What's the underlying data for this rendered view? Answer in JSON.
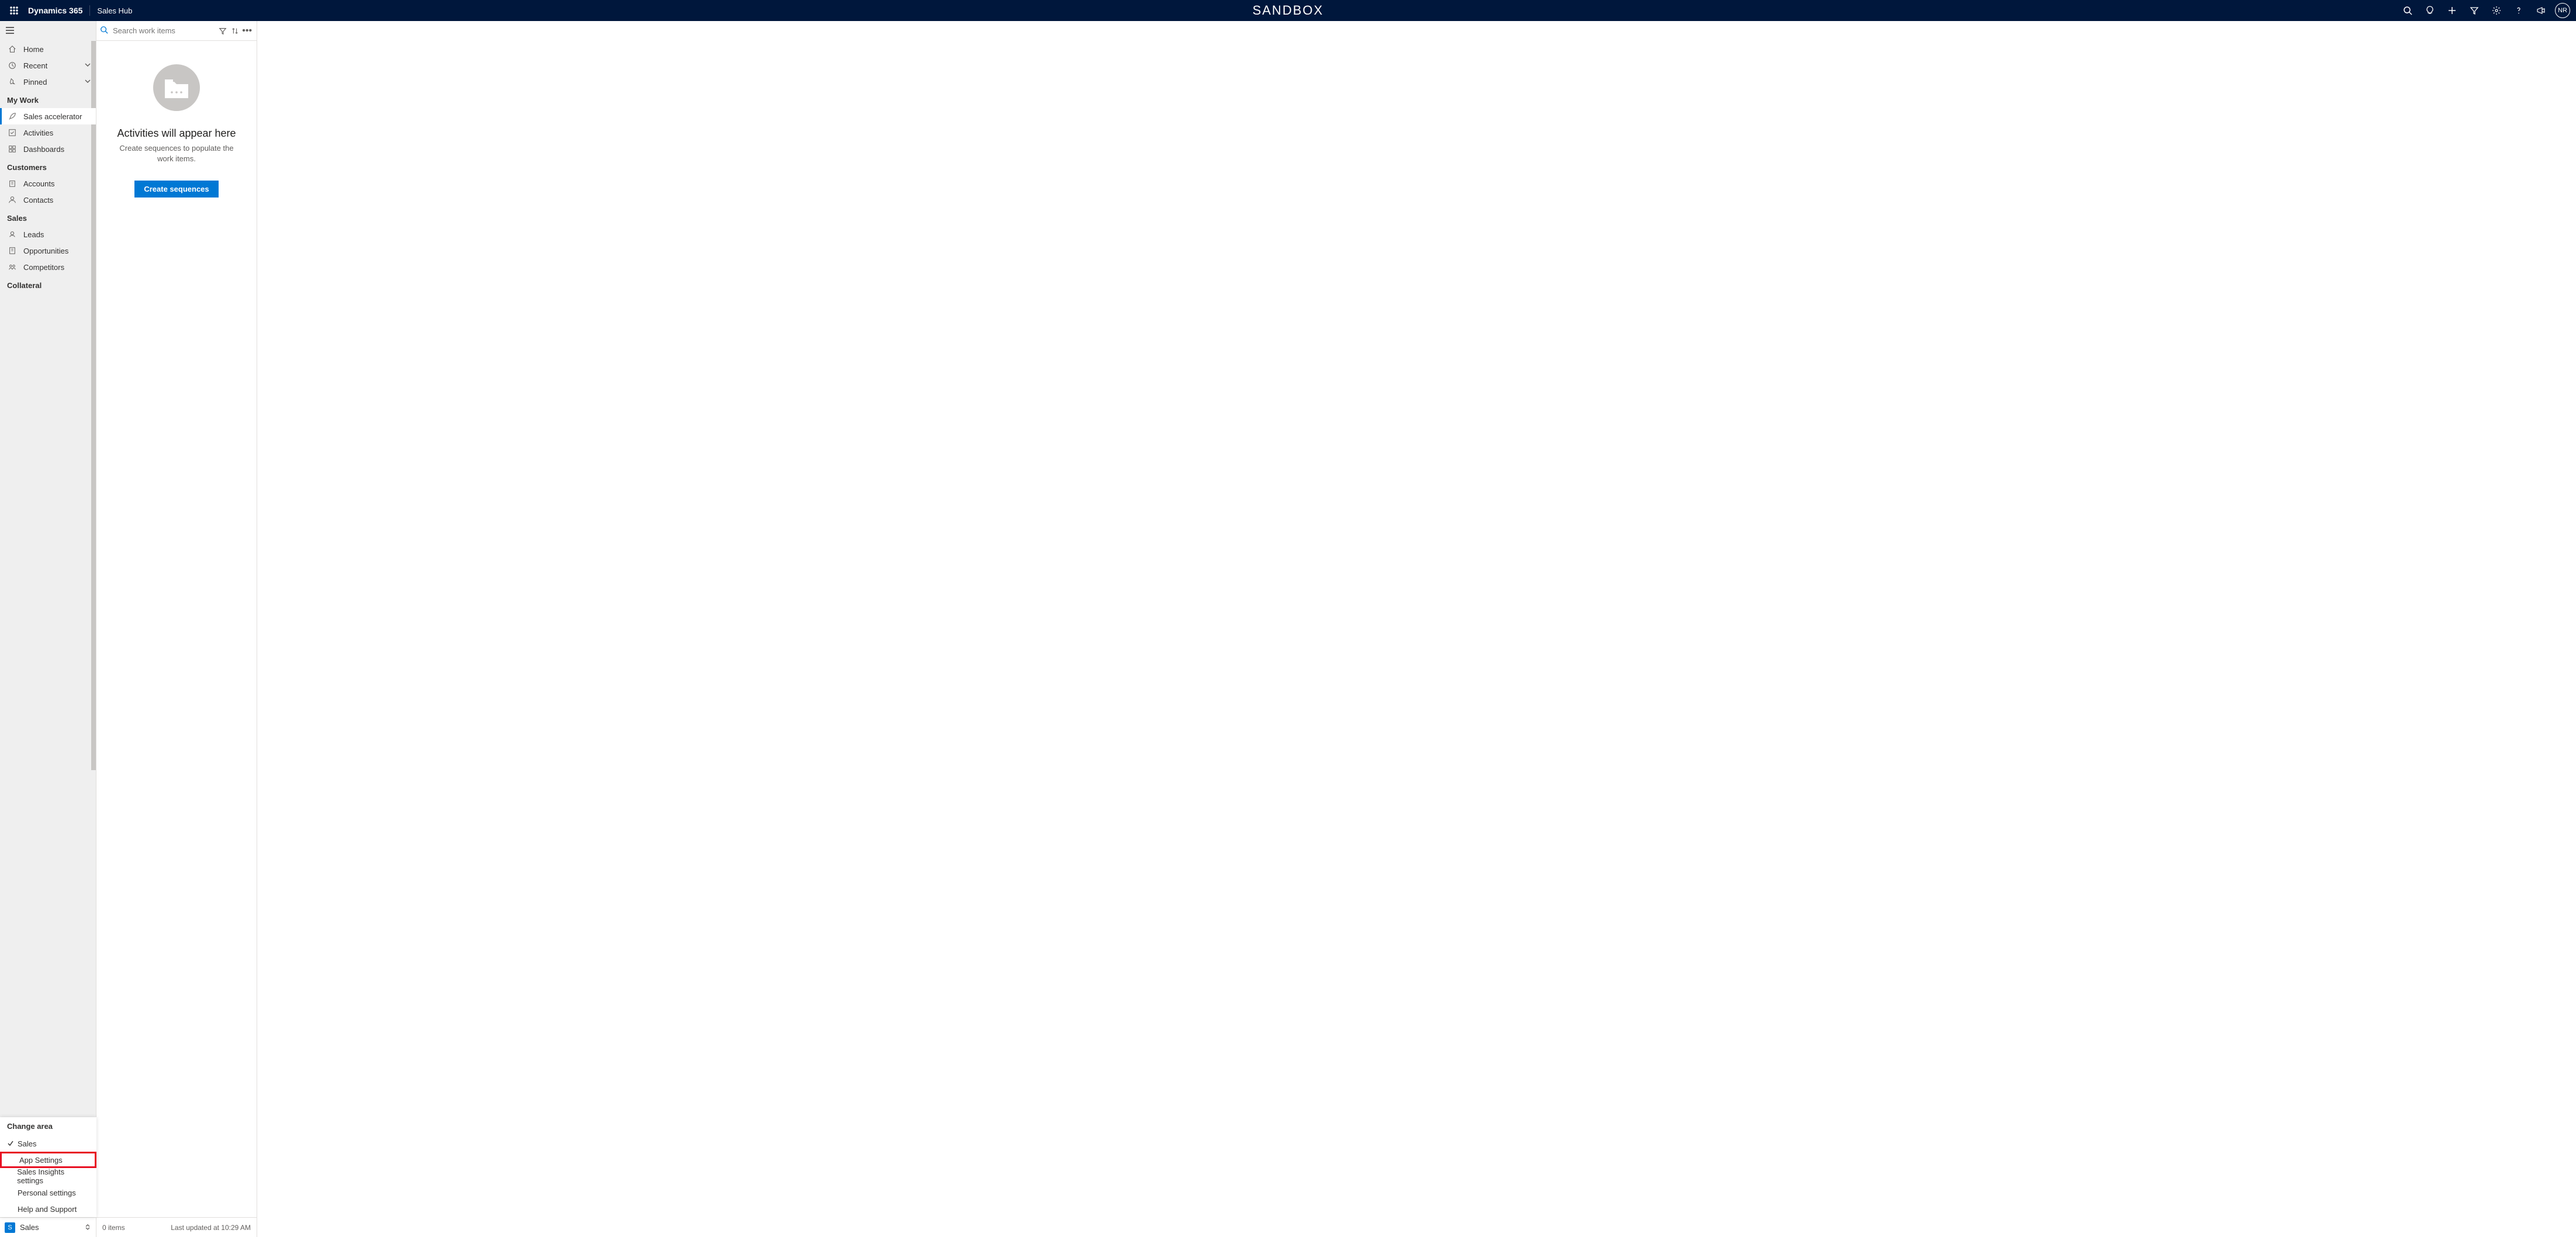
{
  "topbar": {
    "brand": "Dynamics 365",
    "app": "Sales Hub",
    "env": "SANDBOX",
    "avatar": "NR"
  },
  "nav": {
    "home": "Home",
    "recent": "Recent",
    "pinned": "Pinned",
    "group_mywork": "My Work",
    "sales_accel": "Sales accelerator",
    "activities": "Activities",
    "dashboards": "Dashboards",
    "group_customers": "Customers",
    "accounts": "Accounts",
    "contacts": "Contacts",
    "group_sales": "Sales",
    "leads": "Leads",
    "opportunities": "Opportunities",
    "competitors": "Competitors",
    "group_collateral": "Collateral"
  },
  "area": {
    "current_initial": "S",
    "current_label": "Sales",
    "menu_title": "Change area",
    "items": {
      "sales": "Sales",
      "app_settings": "App Settings",
      "insights": "Sales Insights settings",
      "personal": "Personal settings",
      "help": "Help and Support"
    }
  },
  "workpane": {
    "search_placeholder": "Search work items",
    "empty_title": "Activities will appear here",
    "empty_sub": "Create sequences to populate the work items.",
    "create_btn": "Create sequences",
    "status_count": "0 items",
    "status_time": "Last updated at 10:29 AM"
  }
}
